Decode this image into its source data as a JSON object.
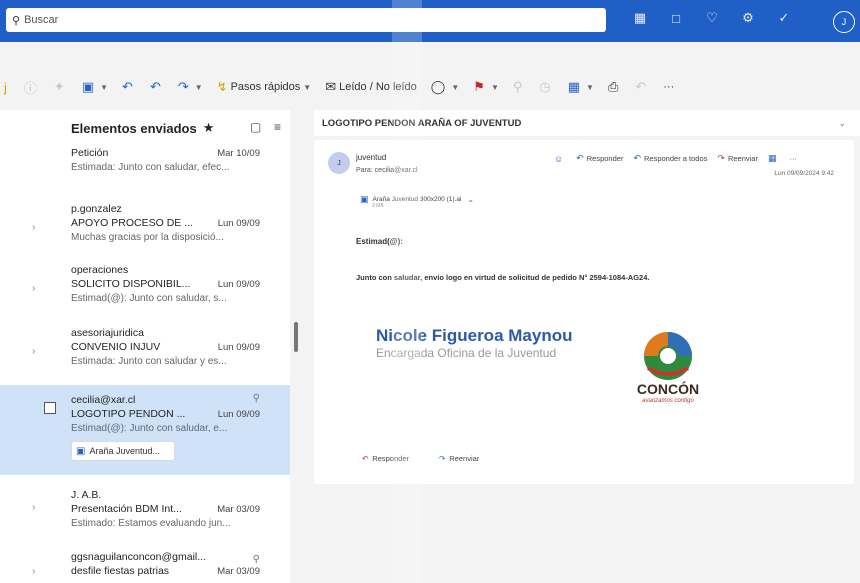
{
  "search": {
    "placeholder": "Buscar"
  },
  "header": {
    "icons": [
      "grid-icon",
      "whiteboard-icon",
      "bell-icon",
      "gear-icon",
      "megaphone-icon"
    ],
    "avatar_initial": "J"
  },
  "ribbon": {
    "quick_steps": "Pasos rápidos",
    "read_unread": "Leído / No leído",
    "more": "···"
  },
  "folder": {
    "title": "Elementos enviados"
  },
  "messages": [
    {
      "sender": "",
      "subject": "Petición",
      "date": "Mar 10/09",
      "preview": "Estimada: Junto con saludar, efec..."
    },
    {
      "sender": "p.gonzalez",
      "subject": "APOYO PROCESO DE ...",
      "date": "Lun 09/09",
      "preview": "Muchas gracias por la disposició..."
    },
    {
      "sender": "operaciones",
      "subject": "SOLICITO DISPONIBIL...",
      "date": "Lun 09/09",
      "preview": "Estimad(@): Junto con saludar, s..."
    },
    {
      "sender": "asesoriajuridica",
      "subject": "CONVENIO INJUV",
      "date": "Lun 09/09",
      "preview": "Estimada: Junto con saludar y es..."
    },
    {
      "sender": "cecilia@xar.cl",
      "subject": "LOGOTIPO PENDON ...",
      "date": "Lun 09/09",
      "preview": "Estimad(@): Junto con saludar, e...",
      "attachment": "Araña Juventud..."
    },
    {
      "sender": "J. A.B.",
      "subject": "Presentación BDM Int...",
      "date": "Mar 03/09",
      "preview": "Estimado: Estamos evaluando jun..."
    },
    {
      "sender": "ggsnaguilanconcon@gmail...",
      "subject": "desfile fiestas patrias",
      "date": "Mar 03/09",
      "preview": ""
    }
  ],
  "reading": {
    "subject": "LOGOTIPO PENDON ARAÑA OF JUVENTUD",
    "from": "juventud",
    "to": "Para: cecilia@xar.cl",
    "reply": "Responder",
    "reply_all": "Responder a todos",
    "forward": "Reenviar",
    "time": "Lun 09/09/2024 9:42",
    "attachment_name": "Araña Juventud 300x200 (1).ai",
    "attachment_size": "3 MB",
    "greeting": "Estimad(@):",
    "body": "Junto con saludar, envío logo en virtud de solicitud de pedido N° 2594-1084-AG24.",
    "signature_name": "Nicole Figueroa Maynou",
    "signature_title": "Encargada Oficina de la Juventud",
    "logo_text": "CONCÓN",
    "logo_tagline": "avanzamos contigo",
    "footer_reply": "Responder",
    "footer_forward": "Reenviar"
  },
  "colors": {
    "brand": "#1f5fc6",
    "selected": "#cfe2f8",
    "signature": "#2b5aa9"
  }
}
